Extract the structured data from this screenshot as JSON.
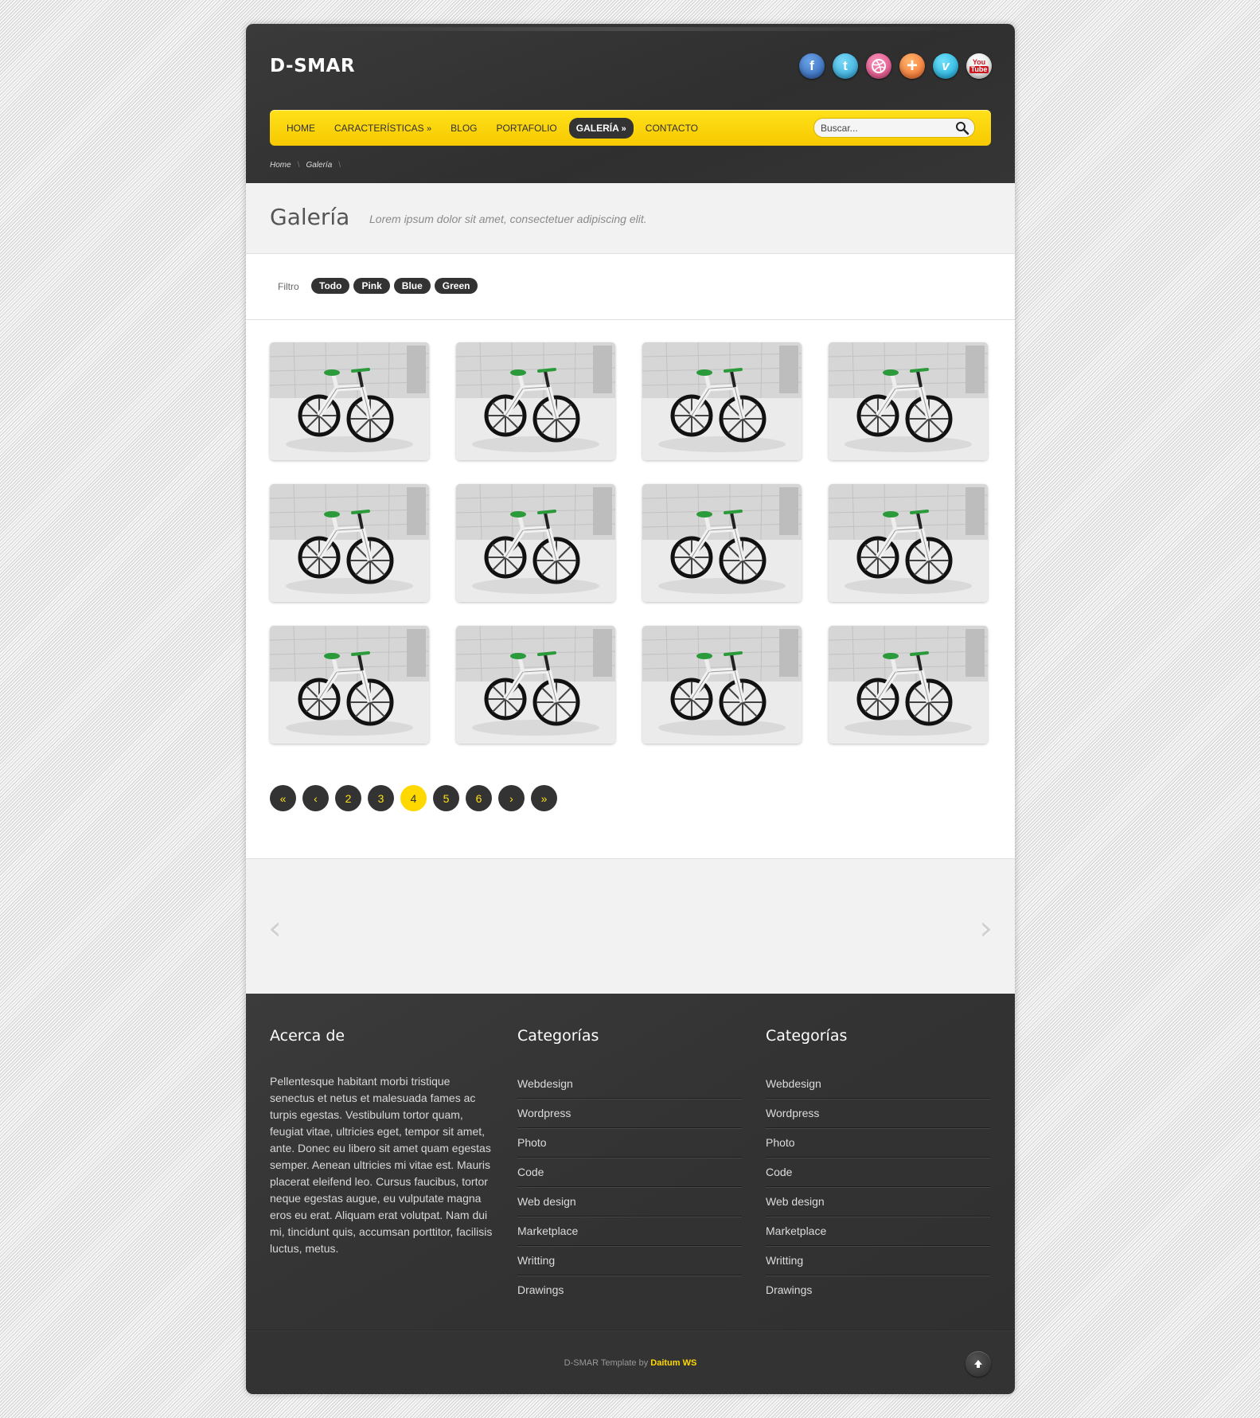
{
  "site": {
    "logo": "D-SMAR"
  },
  "social": [
    {
      "name": "facebook-icon",
      "glyph": "f"
    },
    {
      "name": "twitter-icon",
      "glyph": "t"
    },
    {
      "name": "dribbble-icon",
      "glyph": ""
    },
    {
      "name": "googleplus-icon",
      "glyph": "+"
    },
    {
      "name": "vimeo-icon",
      "glyph": "v"
    },
    {
      "name": "youtube-icon",
      "glyph": ""
    }
  ],
  "nav": {
    "items": [
      "HOME",
      "CARACTERÍSTICAS",
      "BLOG",
      "PORTAFOLIO",
      "GALERÍA",
      "CONTACTO"
    ],
    "active": "GALERÍA",
    "submenu_marker": "»"
  },
  "search": {
    "placeholder": "Buscar..."
  },
  "breadcrumb": {
    "home": "Home",
    "current": "Galería"
  },
  "page": {
    "title": "Galería",
    "subtitle": "Lorem ipsum dolor sit amet, consectetuer adipiscing elit."
  },
  "filter": {
    "label": "Filtro",
    "options": [
      "Todo",
      "Pink",
      "Blue",
      "Green"
    ]
  },
  "gallery": {
    "count": 12,
    "image": "bicycle"
  },
  "pagination": {
    "first": "«",
    "prev": "‹",
    "pages": [
      "2",
      "3",
      "4",
      "5",
      "6"
    ],
    "current": "4",
    "next": "›",
    "last": "»"
  },
  "slider": {
    "prev": "‹",
    "next": "›"
  },
  "footer": {
    "about_title": "Acerca de",
    "about_text": "Pellentesque habitant morbi tristique senectus et netus et malesuada fames ac turpis egestas. Vestibulum tortor quam, feugiat vitae, ultricies eget, tempor sit amet, ante. Donec eu libero sit amet quam egestas semper. Aenean ultricies mi vitae est. Mauris placerat eleifend leo. Cursus faucibus, tortor neque egestas augue, eu vulputate magna eros eu erat. Aliquam erat volutpat. Nam dui mi, tincidunt quis, accumsan porttitor, facilisis luctus, metus.",
    "categories_title_1": "Categorías",
    "categories_title_2": "Categorías",
    "categories": [
      "Webdesign",
      "Wordpress",
      "Photo",
      "Code",
      "Web design",
      "Marketplace",
      "Writting",
      "Drawings"
    ],
    "copyright_prefix": "D-SMAR Template by",
    "copyright_brand": "Daitum WS"
  },
  "colors": {
    "accent": "#ffd800",
    "dark": "#333333",
    "page_bg": "#f2f2f2"
  }
}
